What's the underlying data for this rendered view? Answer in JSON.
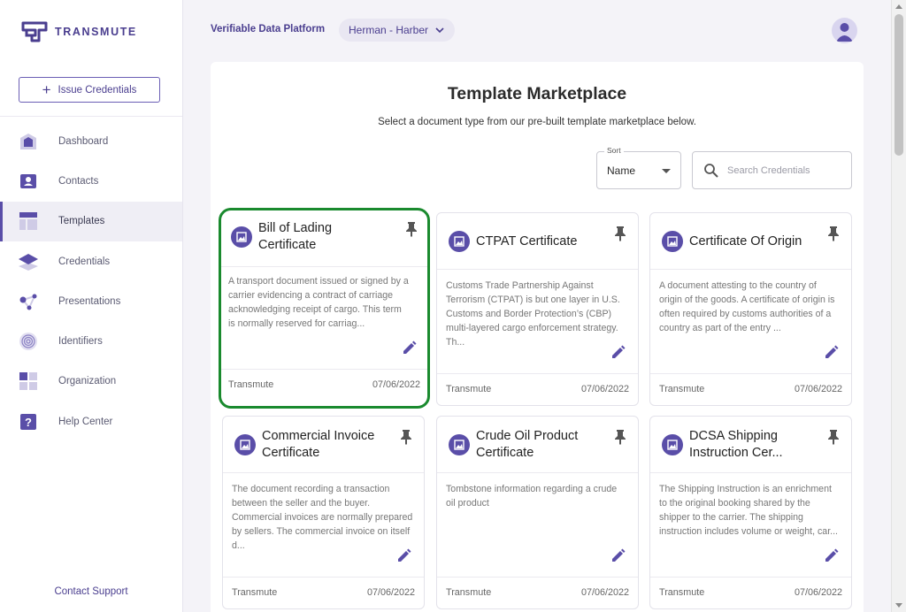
{
  "brand": {
    "name": "TRANSMUTE",
    "logo_icon": "transmute-logo",
    "accent": "#4a3e8f",
    "primary": "#5a4ea8",
    "highlight_border": "#1a8a2e"
  },
  "sidebar": {
    "issue_button_label": "Issue Credentials",
    "items": [
      {
        "label": "Dashboard",
        "icon": "home-icon",
        "active": false
      },
      {
        "label": "Contacts",
        "icon": "contact-card-icon",
        "active": false
      },
      {
        "label": "Templates",
        "icon": "template-grid-icon",
        "active": true
      },
      {
        "label": "Credentials",
        "icon": "layers-icon",
        "active": false
      },
      {
        "label": "Presentations",
        "icon": "network-icon",
        "active": false
      },
      {
        "label": "Identifiers",
        "icon": "fingerprint-icon",
        "active": false
      },
      {
        "label": "Organization",
        "icon": "organization-blocks-icon",
        "active": false
      },
      {
        "label": "Help Center",
        "icon": "help-icon",
        "active": false
      }
    ],
    "contact_support": "Contact Support"
  },
  "header": {
    "platform_title": "Verifiable Data Platform",
    "organization": "Herman - Harber"
  },
  "main": {
    "title": "Template Marketplace",
    "subtitle": "Select a document type from our pre-built template marketplace below.",
    "sort": {
      "label": "Sort",
      "value": "Name"
    },
    "search": {
      "placeholder": "Search Credentials"
    },
    "cards": [
      {
        "title": "Bill of Lading Certificate",
        "description": "A transport document issued or signed by a carrier evidencing a contract of carriage acknowledging receipt of cargo. This term is normally reserved for carriag...",
        "author": "Transmute",
        "date": "07/06/2022",
        "highlighted": true
      },
      {
        "title": "CTPAT Certificate",
        "description": "Customs Trade Partnership Against Terrorism (CTPAT) is but one layer in U.S. Customs and Border Protection’s (CBP) multi-layered cargo enforcement strategy. Th...",
        "author": "Transmute",
        "date": "07/06/2022",
        "highlighted": false
      },
      {
        "title": "Certificate Of Origin",
        "description": "A document attesting to the country of origin of the goods. A certificate of origin is often required by customs authorities of a country as part of the entry ...",
        "author": "Transmute",
        "date": "07/06/2022",
        "highlighted": false
      },
      {
        "title": "Commercial Invoice Certificate",
        "description": "The document recording a transaction between the seller and the buyer. Commercial invoices are normally prepared by sellers. The commercial invoice on itself d...",
        "author": "Transmute",
        "date": "07/06/2022",
        "highlighted": false
      },
      {
        "title": "Crude Oil Product Certificate",
        "description": "Tombstone information regarding a crude oil product",
        "author": "Transmute",
        "date": "07/06/2022",
        "highlighted": false
      },
      {
        "title": "DCSA Shipping Instruction Cer...",
        "description": "The Shipping Instruction is an enrichment to the original booking shared by the shipper to the carrier. The shipping instruction includes volume or weight, car...",
        "author": "Transmute",
        "date": "07/06/2022",
        "highlighted": false
      }
    ]
  }
}
